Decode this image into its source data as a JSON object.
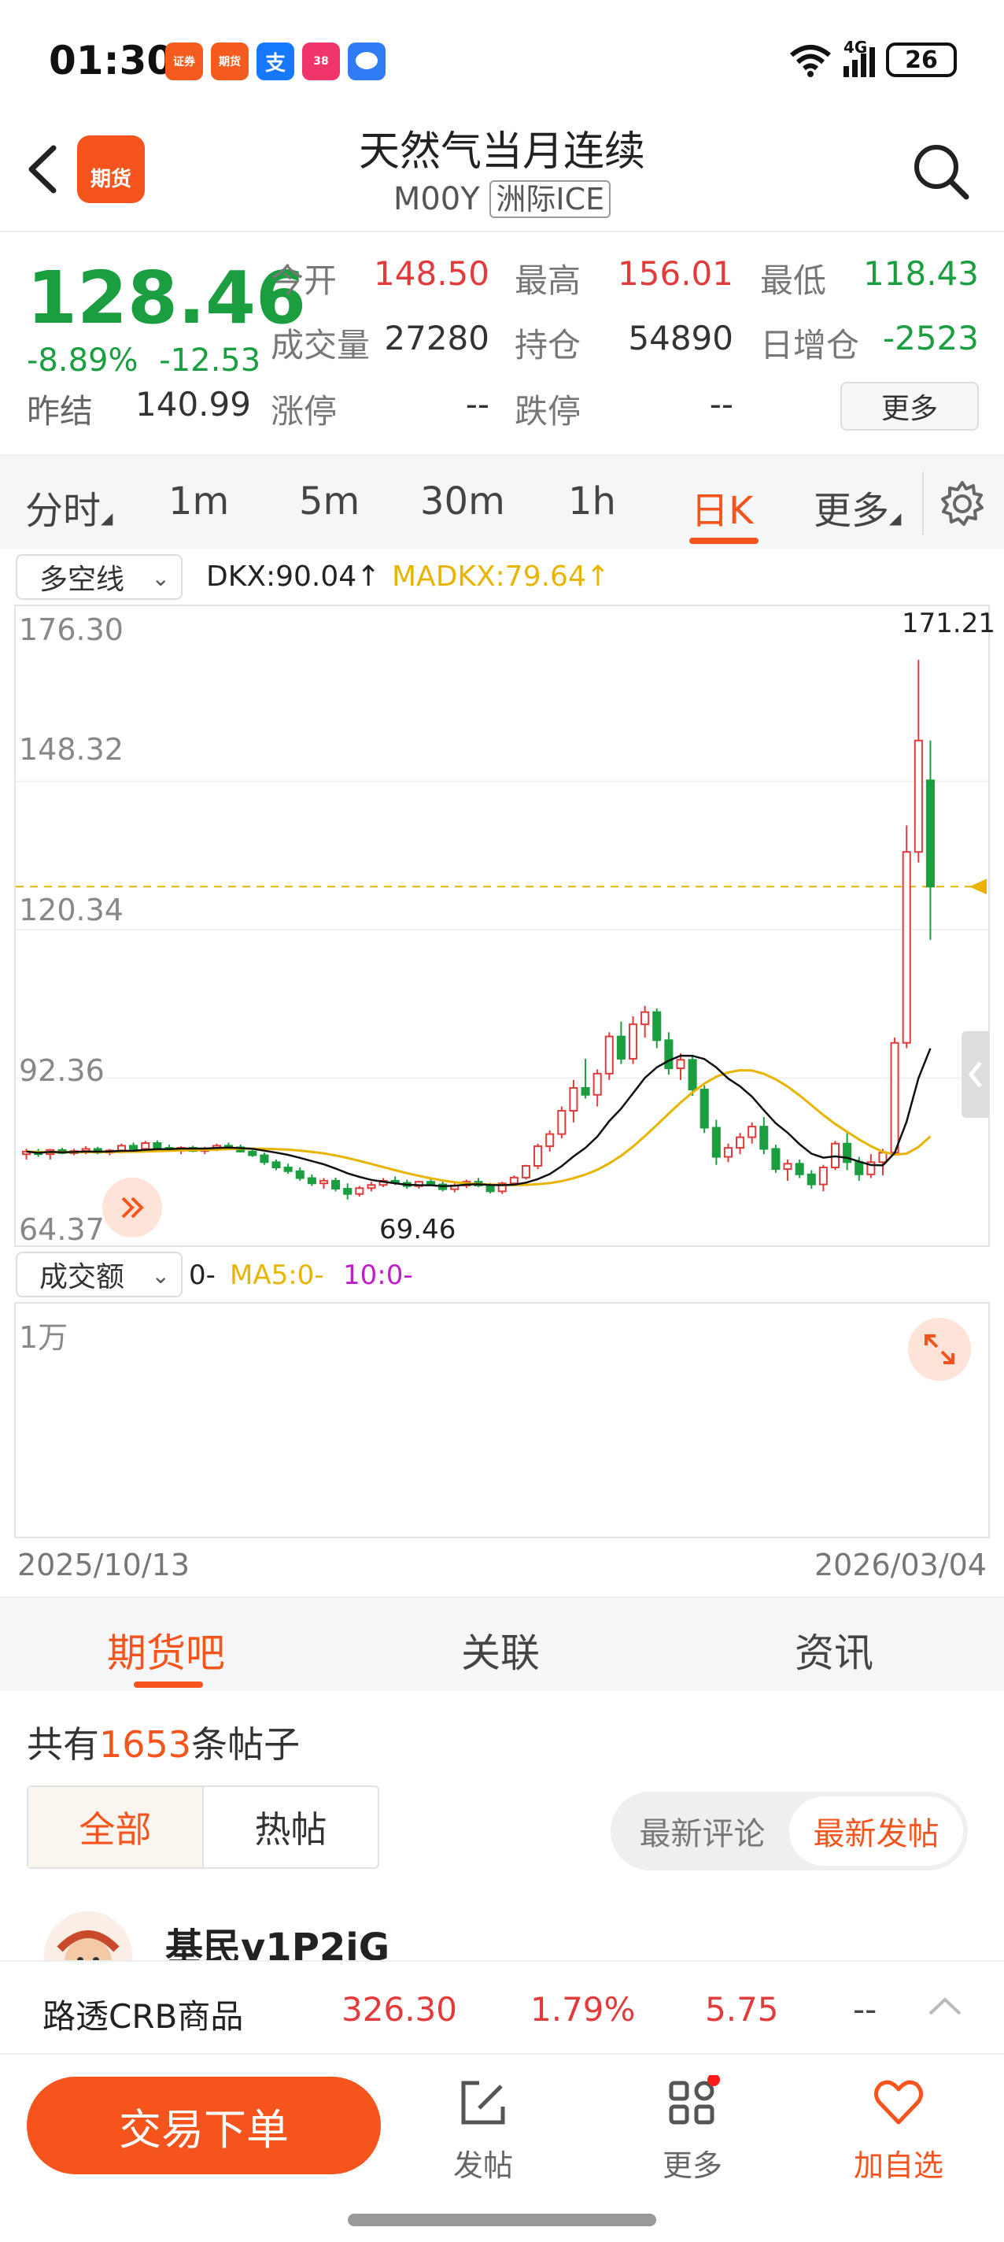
{
  "status_bar": {
    "time": "01:30",
    "signal": "4G",
    "battery": "26",
    "apps": [
      "证券",
      "期货",
      "支",
      "38",
      "msg"
    ]
  },
  "header": {
    "title": "天然气当月连续",
    "code": "M00Y",
    "exchange": "洲际ICE",
    "logo_text": "期货"
  },
  "quote": {
    "price": "128.46",
    "change_pct": "-8.89%",
    "change_abs": "-12.53",
    "prev_close_label": "昨结",
    "prev_close": "140.99",
    "fields": [
      {
        "label": "今开",
        "value": "148.50",
        "color": "#e23b3b"
      },
      {
        "label": "最高",
        "value": "156.01",
        "color": "#e23b3b"
      },
      {
        "label": "最低",
        "value": "118.43",
        "color": "#1a9e3f"
      },
      {
        "label": "成交量",
        "value": "27280",
        "color": "#333333"
      },
      {
        "label": "持仓",
        "value": "54890",
        "color": "#333333"
      },
      {
        "label": "日增仓",
        "value": "-2523",
        "color": "#1a9e3f"
      },
      {
        "label": "涨停",
        "value": "--",
        "color": "#333333"
      },
      {
        "label": "跌停",
        "value": "--",
        "color": "#333333"
      }
    ],
    "more_label": "更多"
  },
  "period_tabs": [
    "分时",
    "1m",
    "5m",
    "30m",
    "1h",
    "日K",
    "更多"
  ],
  "active_period": "日K",
  "indicator": {
    "select": "多空线",
    "dkx": "DKX:90.04↑",
    "madkx": "MADKX:79.64↑"
  },
  "chart_data": {
    "type": "candlestick",
    "y_ticks": [
      "176.30",
      "148.32",
      "120.34",
      "92.36",
      "64.37"
    ],
    "ylim": [
      64.37,
      176.3
    ],
    "high_marker": "171.21",
    "low_marker": "69.46",
    "current_price_line": 128.46,
    "x_start": "2025/10/13",
    "x_end": "2026/03/04",
    "candles": [
      [
        78,
        79,
        77,
        78.5
      ],
      [
        78.5,
        79,
        77.5,
        78
      ],
      [
        78,
        79,
        77,
        78.8
      ],
      [
        78.8,
        79.2,
        78,
        78.2
      ],
      [
        78.2,
        79,
        77.8,
        78.6
      ],
      [
        78.6,
        79.5,
        78,
        79
      ],
      [
        79,
        79.4,
        78,
        78.3
      ],
      [
        78.3,
        79,
        77.8,
        78.7
      ],
      [
        78.7,
        80,
        78.2,
        79.6
      ],
      [
        79.6,
        80.2,
        78.8,
        79
      ],
      [
        79,
        80.5,
        78.6,
        80.1
      ],
      [
        80.1,
        80.6,
        79,
        79.2
      ],
      [
        79.2,
        79.8,
        78.5,
        78.9
      ],
      [
        78.9,
        79.5,
        78,
        79.2
      ],
      [
        79.2,
        79.6,
        78.4,
        78.6
      ],
      [
        78.6,
        79.4,
        78,
        79
      ],
      [
        79,
        80,
        78.6,
        79.6
      ],
      [
        79.6,
        80.2,
        79,
        79.3
      ],
      [
        79.3,
        79.8,
        78.3,
        78.5
      ],
      [
        78.5,
        79.2,
        77.5,
        77.8
      ],
      [
        77.8,
        78.3,
        76,
        76.5
      ],
      [
        76.5,
        77,
        75,
        75.5
      ],
      [
        75.5,
        76.2,
        74.3,
        74.8
      ],
      [
        74.8,
        75.5,
        73,
        73.5
      ],
      [
        73.5,
        74.2,
        72,
        72.5
      ],
      [
        72.5,
        73.5,
        71.5,
        73
      ],
      [
        73,
        73.6,
        71,
        71.5
      ],
      [
        71.5,
        72.5,
        69.46,
        70.5
      ],
      [
        70.5,
        72,
        70,
        71.6
      ],
      [
        71.6,
        72.8,
        71,
        72.2
      ],
      [
        72.2,
        73.5,
        71.8,
        73
      ],
      [
        73,
        73.8,
        72.2,
        72.6
      ],
      [
        72.6,
        73.2,
        71.5,
        72
      ],
      [
        72,
        73,
        71.5,
        72.8
      ],
      [
        72.8,
        73.5,
        72,
        72.3
      ],
      [
        72.3,
        72.8,
        71,
        71.4
      ],
      [
        71.4,
        72.5,
        70.8,
        72.1
      ],
      [
        72.1,
        73.2,
        71.6,
        72.8
      ],
      [
        72.8,
        73.5,
        71.8,
        72.1
      ],
      [
        72.1,
        72.6,
        70.6,
        71
      ],
      [
        71,
        72.8,
        70.5,
        72.5
      ],
      [
        72.5,
        74,
        72,
        73.6
      ],
      [
        73.6,
        76,
        73.2,
        75.8
      ],
      [
        75.8,
        80,
        75.2,
        79.5
      ],
      [
        79.5,
        82.5,
        78.5,
        81.8
      ],
      [
        81.8,
        87,
        81,
        86.2
      ],
      [
        86.2,
        92,
        84,
        90.5
      ],
      [
        90.5,
        96,
        88.5,
        89.2
      ],
      [
        89.2,
        94,
        87,
        93.2
      ],
      [
        93.2,
        101,
        92,
        100.2
      ],
      [
        100.2,
        103,
        95,
        96
      ],
      [
        96,
        104,
        95,
        102.5
      ],
      [
        102.5,
        106,
        100,
        104.8
      ],
      [
        104.8,
        105.5,
        98,
        99.5
      ],
      [
        99.5,
        101,
        93,
        94.2
      ],
      [
        94.2,
        97,
        92,
        95.8
      ],
      [
        95.8,
        96.5,
        89,
        90.2
      ],
      [
        90.2,
        91,
        82,
        83
      ],
      [
        83,
        84.5,
        76,
        77.5
      ],
      [
        77.5,
        80,
        76.5,
        79.2
      ],
      [
        79.2,
        82,
        78,
        81.2
      ],
      [
        81.2,
        84,
        80,
        83.2
      ],
      [
        83.2,
        85,
        78,
        79
      ],
      [
        79,
        79.8,
        74.5,
        75.2
      ],
      [
        75.2,
        77,
        73,
        76.2
      ],
      [
        76.2,
        77,
        73.5,
        74.2
      ],
      [
        74.2,
        75,
        71.5,
        72.3
      ],
      [
        72.3,
        76,
        71,
        75.5
      ],
      [
        75.5,
        80.5,
        75,
        80
      ],
      [
        80,
        82,
        75,
        76.5
      ],
      [
        76.5,
        77.5,
        73,
        74.2
      ],
      [
        74.2,
        78,
        73.5,
        76.5
      ],
      [
        76.5,
        79,
        74,
        78.3
      ],
      [
        78.3,
        100,
        78,
        99
      ],
      [
        99,
        140,
        98,
        135
      ],
      [
        135,
        171.21,
        133,
        156.01
      ],
      [
        148.5,
        156.01,
        118.43,
        128.46
      ]
    ]
  },
  "volume": {
    "select": "成交额",
    "value": "0-",
    "ma5": "MA5:0-",
    "ma10": "10:0-",
    "unit": "1万"
  },
  "forum": {
    "tabs": [
      "期货吧",
      "关联",
      "资讯"
    ],
    "count_prefix": "共有",
    "count": "1653",
    "count_suffix": "条帖子",
    "filters": [
      "全部",
      "热帖"
    ],
    "sorts": [
      "最新评论",
      "最新发帖"
    ],
    "first_user": "基民v1P2iG"
  },
  "ticker": {
    "name": "路透CRB商品",
    "price": "326.30",
    "pct": "1.79%",
    "change": "5.75",
    "extra": "--"
  },
  "bottom_bar": {
    "trade": "交易下单",
    "post": "发帖",
    "more": "更多",
    "favorite": "加自选"
  },
  "colors": {
    "accent": "#f5541d",
    "up": "#e23b3b",
    "down": "#1a9e3f",
    "dkx": "#111111",
    "madkx": "#e8b400"
  }
}
